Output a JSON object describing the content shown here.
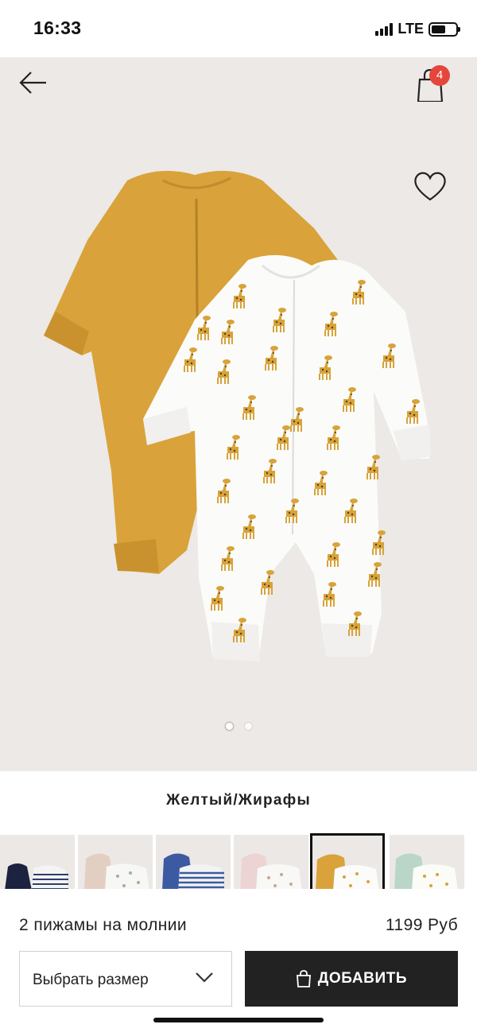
{
  "status_bar": {
    "time": "16:33",
    "network": "LTE"
  },
  "header": {
    "cart_count": "4",
    "back_icon": "arrow-left-icon",
    "cart_icon": "shopping-bag-icon",
    "favorite_icon": "heart-icon"
  },
  "gallery": {
    "image_count": 2,
    "active_index": 0
  },
  "product": {
    "color_name": "Желтый/Жирафы",
    "name": "2 пижамы на молнии",
    "price": "1199 Руб"
  },
  "swatches": [
    {
      "variant": "navy/stripes",
      "selected": false
    },
    {
      "variant": "beige/print",
      "selected": false
    },
    {
      "variant": "blue/stripes",
      "selected": false
    },
    {
      "variant": "pink/print",
      "selected": false
    },
    {
      "variant": "yellow/giraffes",
      "selected": true
    },
    {
      "variant": "mint/print",
      "selected": false
    }
  ],
  "actions": {
    "size_select_label": "Выбрать размер",
    "add_button_label": "ДОБАВИТЬ"
  },
  "colors": {
    "mustard": "#d9a23a",
    "hero_bg": "#ece9e6",
    "badge": "#e4463b",
    "button_dark": "#222222"
  }
}
